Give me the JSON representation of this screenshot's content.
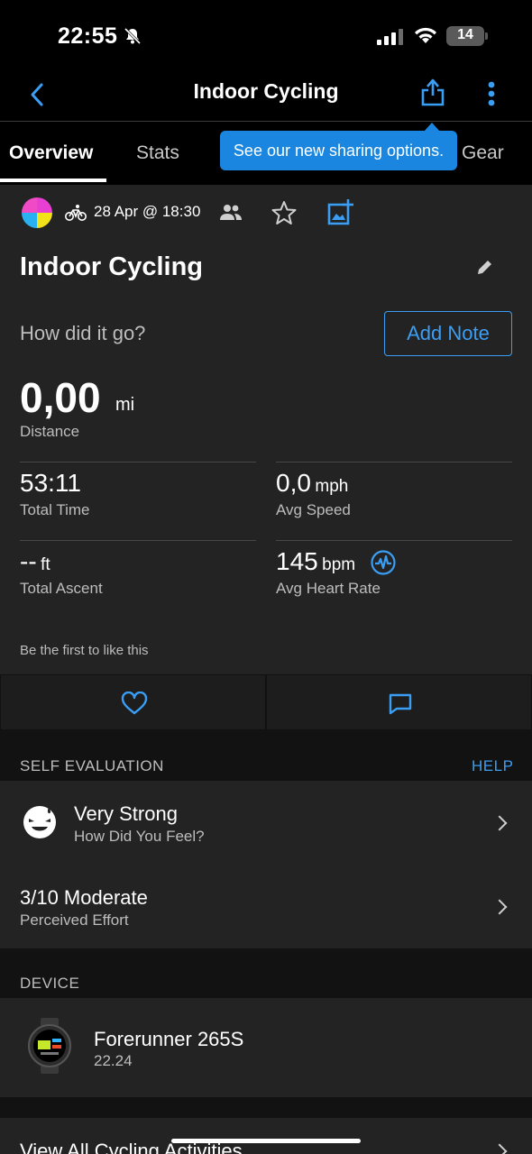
{
  "status_bar": {
    "time": "22:55",
    "battery": "14"
  },
  "nav": {
    "title": "Indoor Cycling"
  },
  "tabs": [
    {
      "label": "Overview"
    },
    {
      "label": "Stats"
    },
    {
      "label": "Gear"
    }
  ],
  "tooltip": {
    "text": "See our new sharing options."
  },
  "activity": {
    "date": "28 Apr @ 18:30",
    "title": "Indoor Cycling",
    "prompt": "How did it go?",
    "add_note_label": "Add Note"
  },
  "distance": {
    "value": "0,00",
    "unit": "mi",
    "label": "Distance"
  },
  "stats": [
    {
      "value": "53:11",
      "unit": "",
      "label": "Total Time"
    },
    {
      "value": "0,0",
      "unit": "mph",
      "label": "Avg Speed"
    },
    {
      "value": "--",
      "unit": "ft",
      "label": "Total Ascent"
    },
    {
      "value": "145",
      "unit": "bpm",
      "label": "Avg Heart Rate"
    }
  ],
  "social": {
    "likes_text": "Be the first to like this"
  },
  "self_evaluation": {
    "header": "SELF EVALUATION",
    "help_label": "HELP",
    "feel": {
      "title": "Very Strong",
      "subtitle": "How Did You Feel?"
    },
    "effort": {
      "title": "3/10 Moderate",
      "subtitle": "Perceived Effort"
    }
  },
  "device": {
    "header": "DEVICE",
    "name": "Forerunner 265S",
    "version": "22.24"
  },
  "footer": {
    "view_all_label": "View All Cycling Activities"
  },
  "colors": {
    "accent": "#3b9ef5",
    "tooltip": "#1a86e0",
    "card": "#232323",
    "background": "#121212"
  }
}
